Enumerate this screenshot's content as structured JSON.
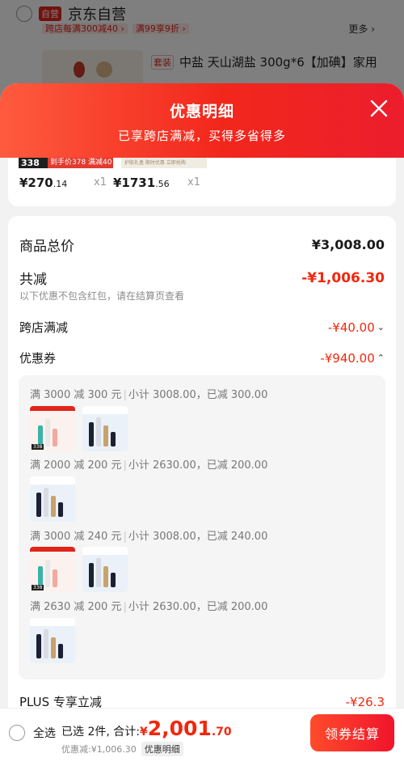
{
  "background": {
    "store_badge": "自营",
    "store_name": "京东自营",
    "promo_tags": [
      "跨店每满300减40 ›",
      "满99享9折 ›"
    ],
    "more_label": "更多 ›",
    "product_tag": "套装",
    "product_title": "中盐 天山湖盐 300g*6【加碘】家用"
  },
  "sheet": {
    "title": "优惠明细",
    "subtitle": "已享跨店满减，买得多省得多"
  },
  "products": [
    {
      "banner_a": "338",
      "banner_b": "到手价378 满减40",
      "price_main": "¥270",
      "price_dec": ".14",
      "qty": "x1"
    },
    {
      "banner_text": "护肤礼盒 限时优惠 立即抢购",
      "price_main": "¥1731",
      "price_dec": ".56",
      "qty": "x1"
    }
  ],
  "summary": {
    "total_label": "商品总价",
    "total_value": "¥3,008.00",
    "reduce_label": "共减",
    "reduce_value": "-¥1,006.30",
    "note": "以下优惠不包含红包，请在结算页查看",
    "cross_store_label": "跨店满减",
    "cross_store_value": "-¥40.00",
    "coupon_label": "优惠券",
    "coupon_value": "-¥940.00"
  },
  "coupons": [
    {
      "rule": "满 3000 减 300 元",
      "detail": "小计 3008.00，已减 300.00"
    },
    {
      "rule": "满 2000 减 200 元",
      "detail": "小计 2630.00，已减 200.00"
    },
    {
      "rule": "满 3000 减 240 元",
      "detail": "小计 3008.00，已减 240.00"
    },
    {
      "rule": "满 2630 减 200 元",
      "detail": "小计 2630.00，已减 200.00"
    }
  ],
  "plus": {
    "label": "PLUS 专享立减",
    "value": "-¥26.3"
  },
  "bottom": {
    "select_all": "全选",
    "selected_text": "已选 2件, 合计:",
    "currency": "¥",
    "total_int": "2,001",
    "total_dec": ".70",
    "saved_text": "优惠减:¥1,006.30",
    "detail_btn": "优惠明细",
    "checkout": "领券结算"
  },
  "colors": {
    "accent_red": "#f2270c",
    "header_gradient_start": "#fe5b3e",
    "header_gradient_end": "#ec1d2d"
  }
}
